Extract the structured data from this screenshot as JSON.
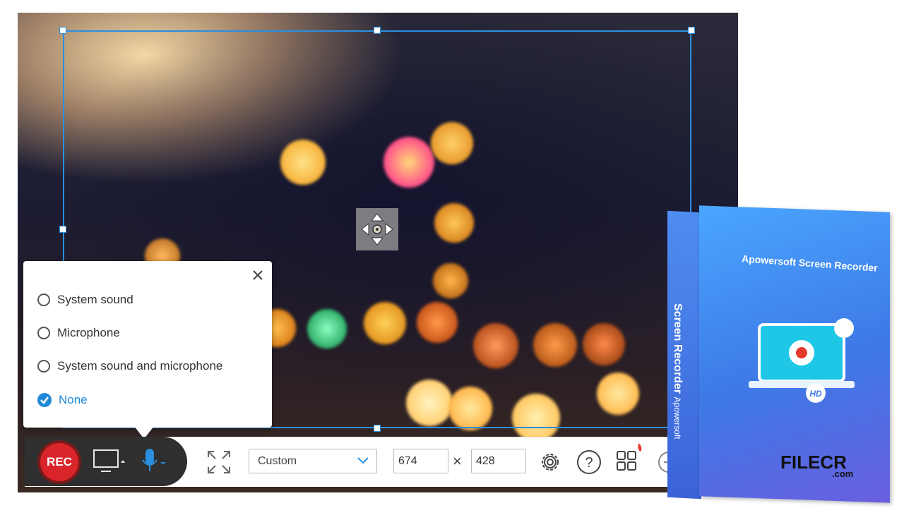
{
  "audio_menu": {
    "options": [
      {
        "label": "System sound",
        "selected": false
      },
      {
        "label": "Microphone",
        "selected": false
      },
      {
        "label": "System sound and microphone",
        "selected": false
      },
      {
        "label": "None",
        "selected": true
      }
    ],
    "close_icon": "close-icon"
  },
  "toolbar": {
    "rec_label": "REC",
    "mode_select_value": "Custom",
    "width_value": "674",
    "height_value": "428",
    "times_symbol": "×"
  },
  "product_box": {
    "title": "Apowersoft Screen Recorder",
    "spine_brand": "Apowersoft",
    "spine_title": "Screen Recorder",
    "badge": "HD"
  },
  "watermark": {
    "main": "FILECR",
    "sub": ".com"
  },
  "colors": {
    "accent": "#1e88d9",
    "selection": "#2a8fe0",
    "rec": "#d9252a"
  }
}
